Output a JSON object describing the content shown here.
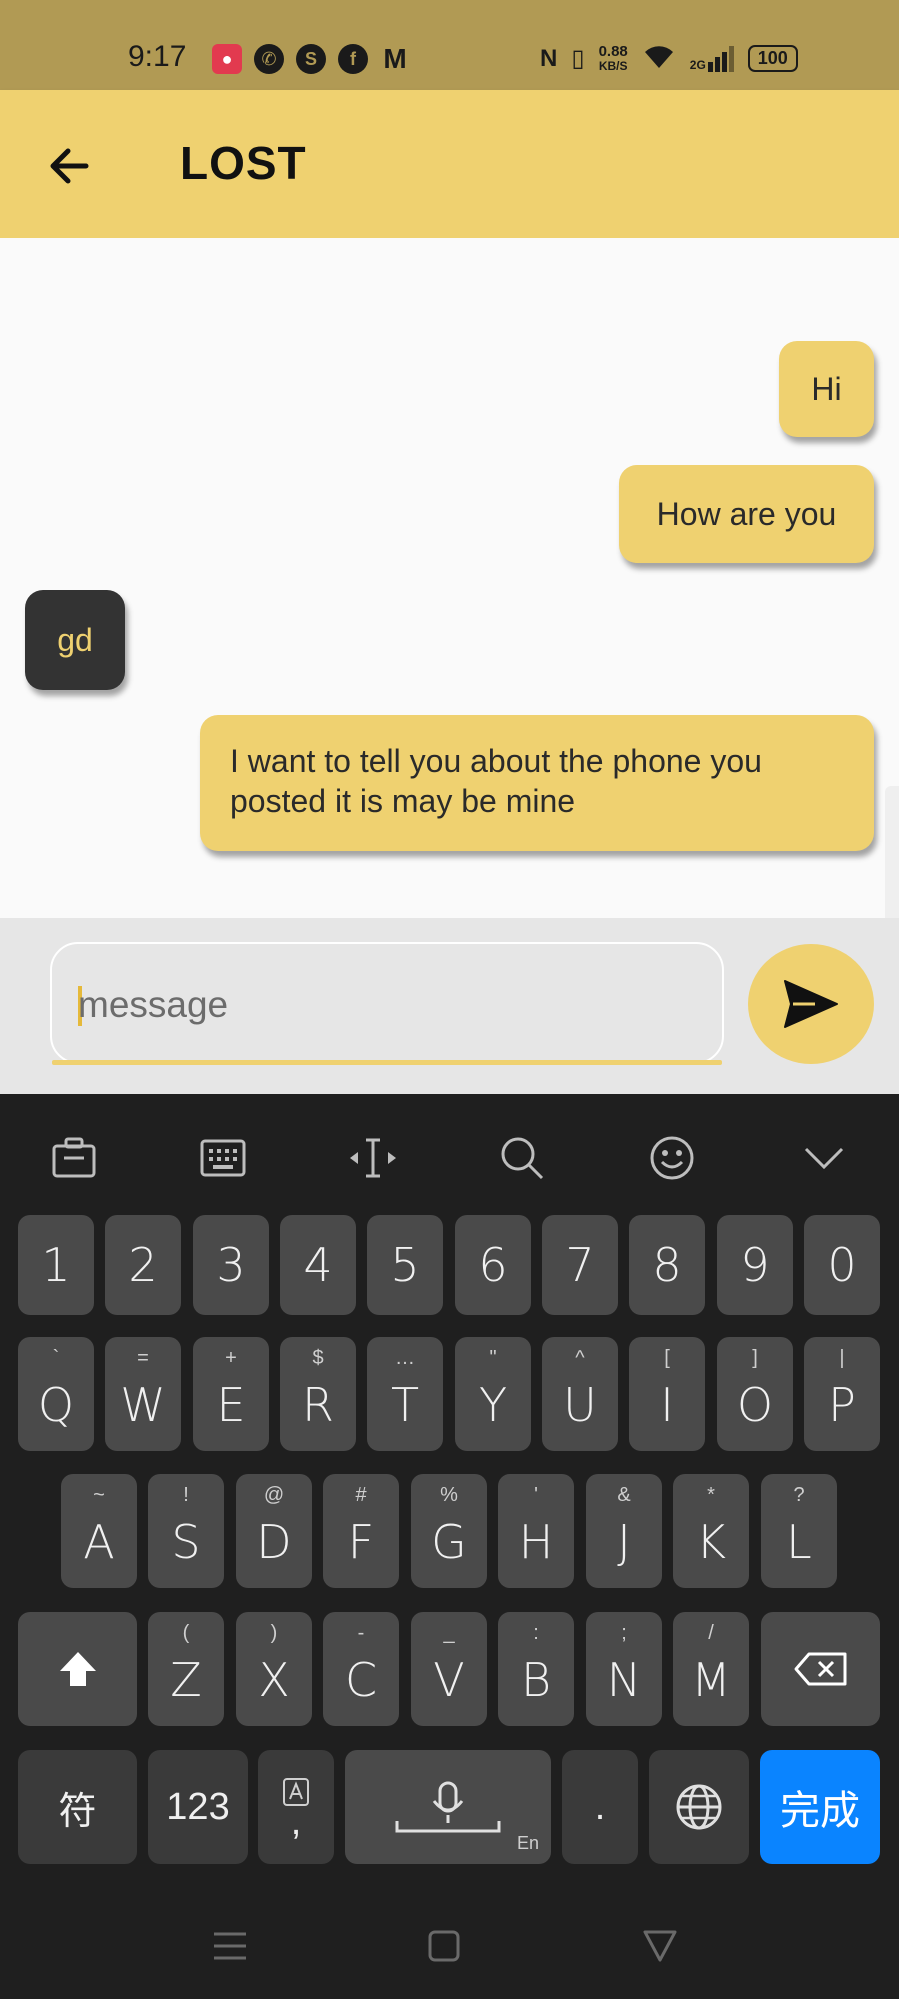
{
  "status_bar": {
    "time": "9:17",
    "net_speed_value": "0.88",
    "net_speed_unit": "KB/S",
    "signal_label": "2G",
    "battery": "100"
  },
  "app_bar": {
    "title": "LOST"
  },
  "messages": [
    {
      "text": "Hi",
      "direction": "out"
    },
    {
      "text": "How are you",
      "direction": "out"
    },
    {
      "text": "gd",
      "direction": "in"
    },
    {
      "text": "I want to tell you about the phone you posted it is may be mine",
      "direction": "out"
    }
  ],
  "composer": {
    "placeholder": "message"
  },
  "colors": {
    "accent": "#efd170",
    "status_bar": "#b19a54",
    "incoming_bubble": "#333333",
    "keyboard_bg": "#1f1f1f",
    "done_key": "#0a84ff"
  },
  "keyboard": {
    "toolbar": [
      "clipboard-icon",
      "keyboard-icon",
      "cursor-icon",
      "search-icon",
      "emoji-icon",
      "collapse-icon"
    ],
    "number_row": [
      "1",
      "2",
      "3",
      "4",
      "5",
      "6",
      "7",
      "8",
      "9",
      "0"
    ],
    "row1": [
      {
        "main": "Q",
        "sub": "`"
      },
      {
        "main": "W",
        "sub": "="
      },
      {
        "main": "E",
        "sub": "+"
      },
      {
        "main": "R",
        "sub": "$"
      },
      {
        "main": "T",
        "sub": "…"
      },
      {
        "main": "Y",
        "sub": "\""
      },
      {
        "main": "U",
        "sub": "^"
      },
      {
        "main": "I",
        "sub": "["
      },
      {
        "main": "O",
        "sub": "]"
      },
      {
        "main": "P",
        "sub": "|"
      }
    ],
    "row2": [
      {
        "main": "A",
        "sub": "~"
      },
      {
        "main": "S",
        "sub": "!"
      },
      {
        "main": "D",
        "sub": "@"
      },
      {
        "main": "F",
        "sub": "#"
      },
      {
        "main": "G",
        "sub": "%"
      },
      {
        "main": "H",
        "sub": "'"
      },
      {
        "main": "J",
        "sub": "&"
      },
      {
        "main": "K",
        "sub": "*"
      },
      {
        "main": "L",
        "sub": "?"
      }
    ],
    "row3": [
      {
        "main": "Z",
        "sub": "("
      },
      {
        "main": "X",
        "sub": ")"
      },
      {
        "main": "C",
        "sub": "-"
      },
      {
        "main": "V",
        "sub": "_"
      },
      {
        "main": "B",
        "sub": ":"
      },
      {
        "main": "N",
        "sub": ";"
      },
      {
        "main": "M",
        "sub": "/"
      }
    ],
    "symbols_key": "符",
    "numbers_key": "123",
    "comma_key": ",",
    "period_key": ".",
    "space_lang": "En",
    "done_key": "完成"
  }
}
